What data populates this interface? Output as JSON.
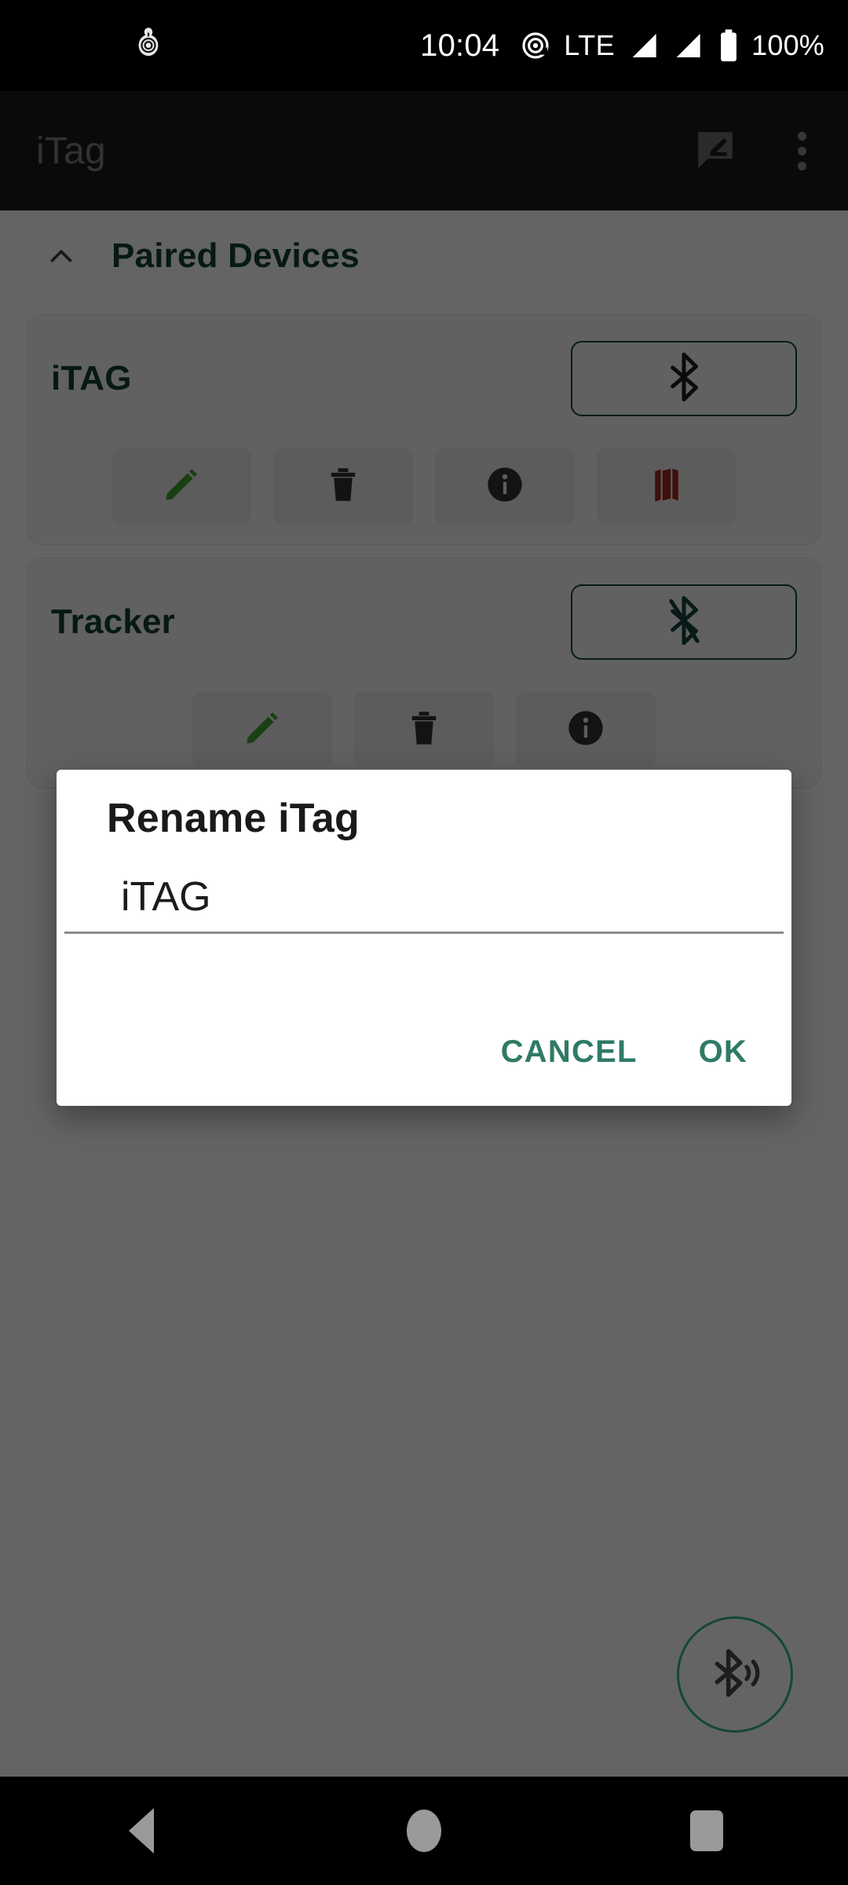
{
  "status_bar": {
    "notification_icon": "itag-keyfob-icon",
    "clock": "10:04",
    "hotspot_icon": "hotspot-icon",
    "network_type": "LTE",
    "signal_icon_1": "signal-bars-icon",
    "signal_icon_2": "signal-bars-icon",
    "battery_icon": "battery-full-icon",
    "battery_level": "100%"
  },
  "app_bar": {
    "title": "iTag",
    "feedback_icon": "feedback-rate-icon",
    "overflow_icon": "overflow-menu-icon"
  },
  "content": {
    "section": {
      "title": "Paired Devices",
      "collapse_icon": "chevron-up-icon"
    },
    "devices": [
      {
        "name": "iTAG",
        "bluetooth_state_icon": "bluetooth-icon",
        "actions": [
          {
            "name": "edit-button",
            "icon": "pencil-icon",
            "color": "#3f9e2e"
          },
          {
            "name": "delete-button",
            "icon": "trash-icon",
            "color": "#303030"
          },
          {
            "name": "info-button",
            "icon": "info-circle-icon",
            "color": "#303030"
          },
          {
            "name": "map-button",
            "icon": "map-icon",
            "color": "#9c2a22"
          }
        ]
      },
      {
        "name": "Tracker",
        "bluetooth_state_icon": "bluetooth-disabled-icon",
        "actions": [
          {
            "name": "edit-button",
            "icon": "pencil-icon",
            "color": "#3f9e2e"
          },
          {
            "name": "delete-button",
            "icon": "trash-icon",
            "color": "#303030"
          },
          {
            "name": "info-button",
            "icon": "info-circle-icon",
            "color": "#303030"
          }
        ]
      }
    ]
  },
  "fab": {
    "icon": "bluetooth-searching-icon"
  },
  "dialog": {
    "title": "Rename iTag",
    "input_value": "iTAG",
    "input_placeholder": "iTAG",
    "cancel_label": "CANCEL",
    "ok_label": "OK"
  },
  "nav_bar": {
    "back_icon": "back-triangle-icon",
    "home_icon": "home-circle-icon",
    "recents_icon": "recents-square-icon"
  },
  "colors": {
    "accent_green": "#10402f",
    "dialog_action": "#2f7a66",
    "app_bar_bg": "#1b1b1b",
    "scrim": "rgba(0,0,0,0.60)"
  }
}
